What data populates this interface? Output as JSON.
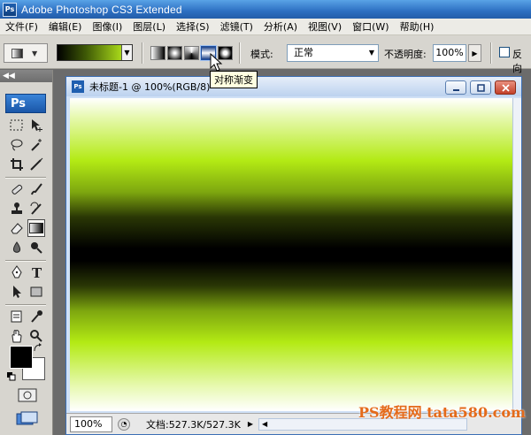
{
  "app": {
    "title": "Adobe Photoshop CS3 Extended",
    "icon_label": "Ps"
  },
  "menubar": [
    "文件(F)",
    "编辑(E)",
    "图像(I)",
    "图层(L)",
    "选择(S)",
    "滤镜(T)",
    "分析(A)",
    "视图(V)",
    "窗口(W)",
    "帮助(H)"
  ],
  "options_bar": {
    "tool_icon": "gradient-tool-icon",
    "gradient_types": [
      "linear",
      "radial",
      "angle",
      "reflected",
      "diamond"
    ],
    "active_gradient_type": "reflected",
    "mode_label": "模式:",
    "mode_value": "正常",
    "opacity_label": "不透明度:",
    "opacity_value": "100%",
    "reverse_label": "反向",
    "reverse_checked": false,
    "tooltip": "对称渐变"
  },
  "toolbox": {
    "logo": "Ps",
    "selected_tool": "gradient-tool",
    "foreground_color": "#000000",
    "background_color": "#ffffff"
  },
  "document": {
    "icon_label": "Ps",
    "title": "未标题-1 @ 100%(RGB/8)",
    "zoom": "100%",
    "doc_info": "文档:527.3K/527.3K",
    "gradient_colors": [
      "#ffffff",
      "#b3ea14",
      "#000000"
    ]
  },
  "watermark": "PS教程网 tata580.com"
}
